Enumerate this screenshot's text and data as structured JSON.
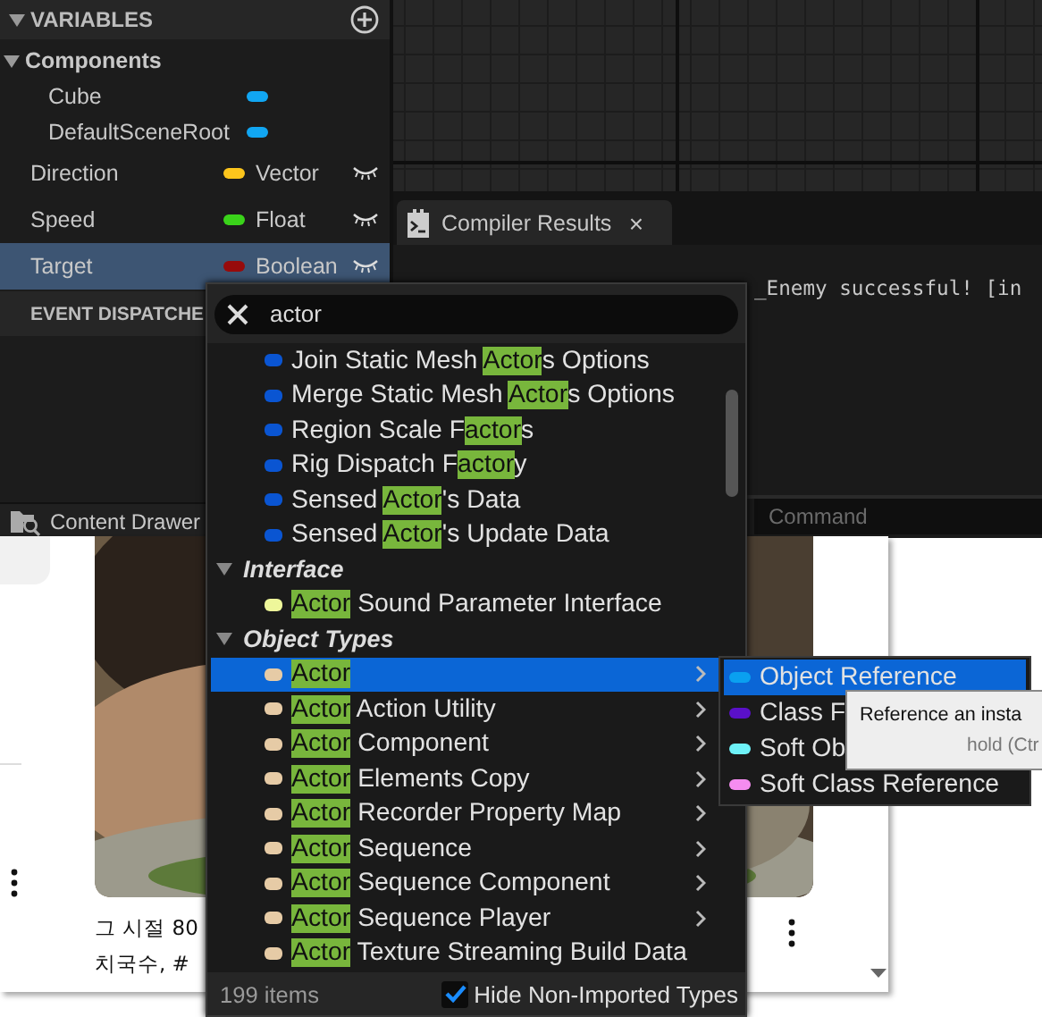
{
  "variables_panel": {
    "title": "VARIABLES",
    "groups": [
      {
        "label": "Components",
        "expanded": true,
        "children": [
          {
            "name": "Cube",
            "color": "#11a6f2"
          },
          {
            "name": "DefaultSceneRoot",
            "color": "#11a6f2"
          }
        ]
      }
    ],
    "variables": [
      {
        "name": "Direction",
        "type": "Vector",
        "color": "#fcc51c",
        "selected": false
      },
      {
        "name": "Speed",
        "type": "Float",
        "color": "#3ad31a",
        "selected": false
      },
      {
        "name": "Target",
        "type": "Boolean",
        "color": "#970b0b",
        "selected": true
      }
    ],
    "dispatchers_title": "EVENT DISPATCHE"
  },
  "content_drawer": {
    "label": "Content Drawer"
  },
  "compiler_results": {
    "tab": {
      "label": "Compiler Results",
      "close": "×"
    },
    "log": [
      "_Enemy successful! [in"
    ],
    "command": {
      "placeholder": "Command"
    }
  },
  "type_menu": {
    "search": {
      "value": "actor"
    },
    "rows": [
      {
        "kind": "item",
        "color": "#0a55d2",
        "submenu": false,
        "selected": false,
        "parts": [
          {
            "text": "Join Static Mesh "
          },
          {
            "text": "Actor",
            "match": true
          },
          {
            "text": "s Options"
          }
        ]
      },
      {
        "kind": "item",
        "color": "#0a55d2",
        "submenu": false,
        "selected": false,
        "parts": [
          {
            "text": "Merge Static Mesh "
          },
          {
            "text": "Actor",
            "match": true
          },
          {
            "text": "s Options"
          }
        ]
      },
      {
        "kind": "item",
        "color": "#0a55d2",
        "submenu": false,
        "selected": false,
        "parts": [
          {
            "text": "Region Scale F"
          },
          {
            "text": "actor",
            "match": true
          },
          {
            "text": "s"
          }
        ]
      },
      {
        "kind": "item",
        "color": "#0a55d2",
        "submenu": false,
        "selected": false,
        "parts": [
          {
            "text": "Rig Dispatch F"
          },
          {
            "text": "actor",
            "match": true
          },
          {
            "text": "y"
          }
        ]
      },
      {
        "kind": "item",
        "color": "#0a55d2",
        "submenu": false,
        "selected": false,
        "parts": [
          {
            "text": "Sensed "
          },
          {
            "text": "Actor",
            "match": true
          },
          {
            "text": "'s Data"
          }
        ]
      },
      {
        "kind": "item",
        "color": "#0a55d2",
        "submenu": false,
        "selected": false,
        "parts": [
          {
            "text": "Sensed "
          },
          {
            "text": "Actor",
            "match": true
          },
          {
            "text": "'s Update Data"
          }
        ]
      },
      {
        "kind": "header",
        "label": "Interface",
        "expanded": true
      },
      {
        "kind": "item",
        "color": "#eef79a",
        "submenu": false,
        "selected": false,
        "parts": [
          {
            "text": "Actor",
            "match": true
          },
          {
            "text": " Sound Parameter Interface"
          }
        ]
      },
      {
        "kind": "header",
        "label": "Object Types",
        "expanded": true
      },
      {
        "kind": "item",
        "color": "#e6cba6",
        "submenu": true,
        "selected": true,
        "parts": [
          {
            "text": "Actor",
            "match": true
          }
        ]
      },
      {
        "kind": "item",
        "color": "#e6cba6",
        "submenu": true,
        "selected": false,
        "parts": [
          {
            "text": "Actor",
            "match": true
          },
          {
            "text": " Action Utility"
          }
        ]
      },
      {
        "kind": "item",
        "color": "#e6cba6",
        "submenu": true,
        "selected": false,
        "parts": [
          {
            "text": "Actor",
            "match": true
          },
          {
            "text": " Component"
          }
        ]
      },
      {
        "kind": "item",
        "color": "#e6cba6",
        "submenu": true,
        "selected": false,
        "parts": [
          {
            "text": "Actor",
            "match": true
          },
          {
            "text": " Elements Copy"
          }
        ]
      },
      {
        "kind": "item",
        "color": "#e6cba6",
        "submenu": true,
        "selected": false,
        "parts": [
          {
            "text": "Actor",
            "match": true
          },
          {
            "text": " Recorder Property Map"
          }
        ]
      },
      {
        "kind": "item",
        "color": "#e6cba6",
        "submenu": true,
        "selected": false,
        "parts": [
          {
            "text": "Actor",
            "match": true
          },
          {
            "text": " Sequence"
          }
        ]
      },
      {
        "kind": "item",
        "color": "#e6cba6",
        "submenu": true,
        "selected": false,
        "parts": [
          {
            "text": "Actor",
            "match": true
          },
          {
            "text": " Sequence Component"
          }
        ]
      },
      {
        "kind": "item",
        "color": "#e6cba6",
        "submenu": true,
        "selected": false,
        "parts": [
          {
            "text": "Actor",
            "match": true
          },
          {
            "text": " Sequence Player"
          }
        ]
      },
      {
        "kind": "item",
        "color": "#e6cba6",
        "submenu": false,
        "selected": false,
        "parts": [
          {
            "text": "Actor",
            "match": true
          },
          {
            "text": " Texture Streaming Build Data"
          }
        ]
      }
    ],
    "count": "199 items",
    "filter": {
      "label": "Hide Non-Imported Types",
      "checked": true
    }
  },
  "reference_submenu": [
    {
      "label": "Object Reference",
      "color": "#0aa0f0",
      "selected": true
    },
    {
      "label": "Class F",
      "color": "#5a10c8",
      "selected": false
    },
    {
      "label": "Soft Ob",
      "color": "#6ef2f8",
      "selected": false
    },
    {
      "label": "Soft Class Reference",
      "color": "#f58cf0",
      "selected": false
    }
  ],
  "tooltip": {
    "text": "Reference an insta",
    "hint": "hold (Ctr"
  },
  "web_page": {
    "photo": {
      "kind": "picture"
    },
    "caption": [
      "그 시절 80",
      "치국수, #"
    ]
  }
}
